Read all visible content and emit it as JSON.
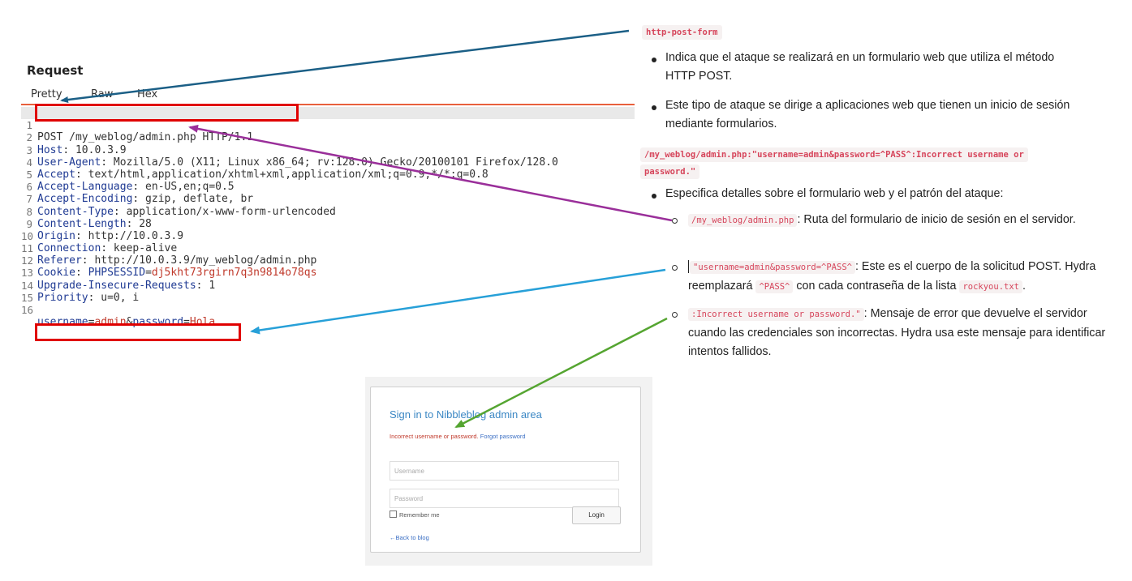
{
  "request": {
    "title": "Request",
    "tabs": [
      "Pretty",
      "Raw",
      "Hex"
    ],
    "lines": [
      {
        "n": "1",
        "request_line": "POST /my_weblog/admin.php HTTP/1.1"
      },
      {
        "n": "2",
        "name": "Host",
        "value": " 10.0.3.9"
      },
      {
        "n": "3",
        "name": "User-Agent",
        "value": " Mozilla/5.0 (X11; Linux x86_64; rv:128.0) Gecko/20100101 Firefox/128.0"
      },
      {
        "n": "4",
        "name": "Accept",
        "value": " text/html,application/xhtml+xml,application/xml;q=0.9,*/*;q=0.8"
      },
      {
        "n": "5",
        "name": "Accept-Language",
        "value": " en-US,en;q=0.5"
      },
      {
        "n": "6",
        "name": "Accept-Encoding",
        "value": " gzip, deflate, br"
      },
      {
        "n": "7",
        "name": "Content-Type",
        "value": " application/x-www-form-urlencoded"
      },
      {
        "n": "8",
        "name": "Content-Length",
        "value": " 28"
      },
      {
        "n": "9",
        "name": "Origin",
        "value": " http://10.0.3.9"
      },
      {
        "n": "10",
        "name": "Connection",
        "value": " keep-alive"
      },
      {
        "n": "11",
        "name": "Referer",
        "value": " http://10.0.3.9/my_weblog/admin.php"
      },
      {
        "n": "12",
        "name": "Cookie",
        "cookie_name": "PHPSESSID",
        "cookie_value": "dj5kht73rgirn7q3n9814o78qs"
      },
      {
        "n": "13",
        "name": "Upgrade-Insecure-Requests",
        "value": " 1"
      },
      {
        "n": "14",
        "name": "Priority",
        "value": " u=0, i"
      },
      {
        "n": "15"
      },
      {
        "n": "16",
        "body": [
          {
            "k": "username",
            "v": "admin"
          },
          {
            "k": "password",
            "v": "Hola"
          }
        ]
      }
    ]
  },
  "notes": {
    "chip_post_form": "http-post-form",
    "bullet1": "Indica que el ataque se realizará en un formulario web que utiliza el método HTTP POST.",
    "bullet2": "Este tipo de ataque se dirige a aplicaciones web que tienen un inicio de sesión mediante formularios.",
    "chip_form_spec_line1": "/my_weblog/admin.php:\"username=admin&password=^PASS^:Incorrect username or",
    "chip_form_spec_line2": "password.\"",
    "bullet3": "Especifica detalles sobre el formulario web y el patrón del ataque:",
    "sub1_code": "/my_weblog/admin.php",
    "sub1_text": ": Ruta del formulario de inicio de sesión en el servidor.",
    "sub2_code": "\"username=admin&password=^PASS^",
    "sub2_text_a": ": Este es el cuerpo de la solicitud POST. Hydra reemplazará ",
    "sub2_code_b": "^PASS^",
    "sub2_text_b": " con cada contraseña de la lista ",
    "sub2_code_c": "rockyou.txt",
    "sub2_text_c": ".",
    "sub3_code": ":Incorrect username or password.\"",
    "sub3_text": ": Mensaje de error que devuelve el servidor cuando las credenciales son incorrectas. Hydra usa este mensaje para identificar intentos fallidos."
  },
  "login": {
    "title": "Sign in to Nibbleblog admin area",
    "error": "Incorrect username or password.",
    "forgot": "Forgot password",
    "username_placeholder": "Username",
    "password_placeholder": "Password",
    "remember": "Remember me",
    "login_button": "Login",
    "back": "←Back to blog"
  },
  "colors": {
    "highlight_box": "#e00000",
    "arrow_blue_dark": "#1b5f86",
    "arrow_purple": "#9a2f9a",
    "arrow_cyan": "#27a0d8",
    "arrow_green": "#55a531",
    "chip_text": "#d6455b"
  }
}
